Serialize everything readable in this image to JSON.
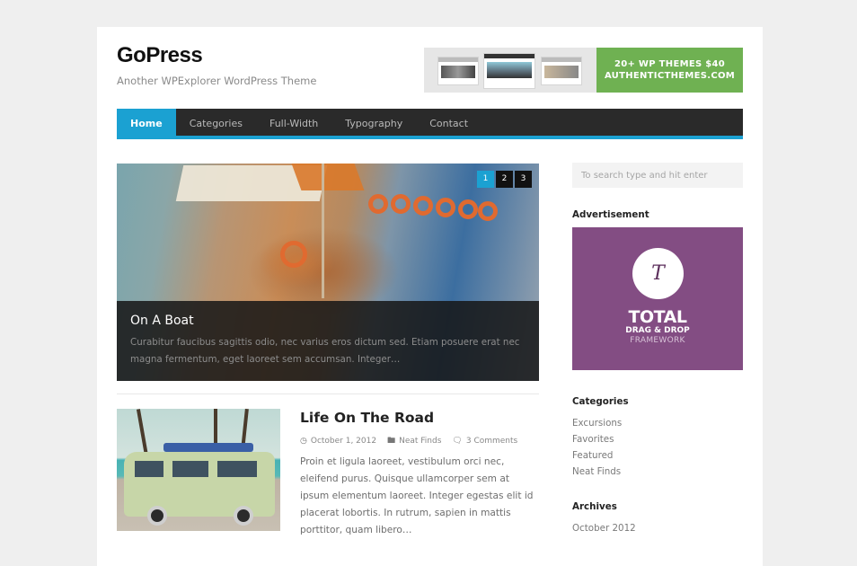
{
  "header": {
    "site_title": "GoPress",
    "site_description": "Another WPExplorer WordPress Theme",
    "banner": {
      "line1": "20+ WP THEMES $40",
      "line2": "AUTHENTICTHEMES.COM",
      "color": "#6fb152"
    }
  },
  "nav": {
    "accent_color": "#1ba1d2",
    "items": [
      {
        "label": "Home",
        "active": true
      },
      {
        "label": "Categories",
        "active": false
      },
      {
        "label": "Full-Width",
        "active": false
      },
      {
        "label": "Typography",
        "active": false
      },
      {
        "label": "Contact",
        "active": false
      }
    ]
  },
  "slider": {
    "pages": [
      "1",
      "2",
      "3"
    ],
    "current_page": "1",
    "image": "sailboat-photo",
    "title": "On A Boat",
    "excerpt": "Curabitur faucibus sagittis odio, nec varius eros dictum sed. Etiam posuere erat nec magna fermentum, eget laoreet sem accumsan. Integer…"
  },
  "post": {
    "thumbnail": "vintage-van-photo",
    "title": "Life On The Road",
    "date": "October 1, 2012",
    "category": "Neat Finds",
    "comments": "3 Comments",
    "icons": {
      "date": "clock-icon",
      "category": "folder-icon",
      "comments": "comments-icon"
    },
    "excerpt": "Proin et ligula laoreet, vestibulum orci nec, eleifend purus. Quisque ullamcorper sem at ipsum elementum laoreet. Integer egestas elit id placerat lobortis. In rutrum, sapien in mattis porttitor, quam libero…"
  },
  "sidebar": {
    "search_placeholder": "To search type and hit enter",
    "advertisement": {
      "title": "Advertisement",
      "logo_letter": "T",
      "line1": "TOTAL",
      "line2": "DRAG & DROP",
      "line3": "FRAMEWORK",
      "color": "#834d83"
    },
    "categories": {
      "title": "Categories",
      "items": [
        "Excursions",
        "Favorites",
        "Featured",
        "Neat Finds"
      ]
    },
    "archives": {
      "title": "Archives",
      "items": [
        "October 2012"
      ]
    }
  }
}
